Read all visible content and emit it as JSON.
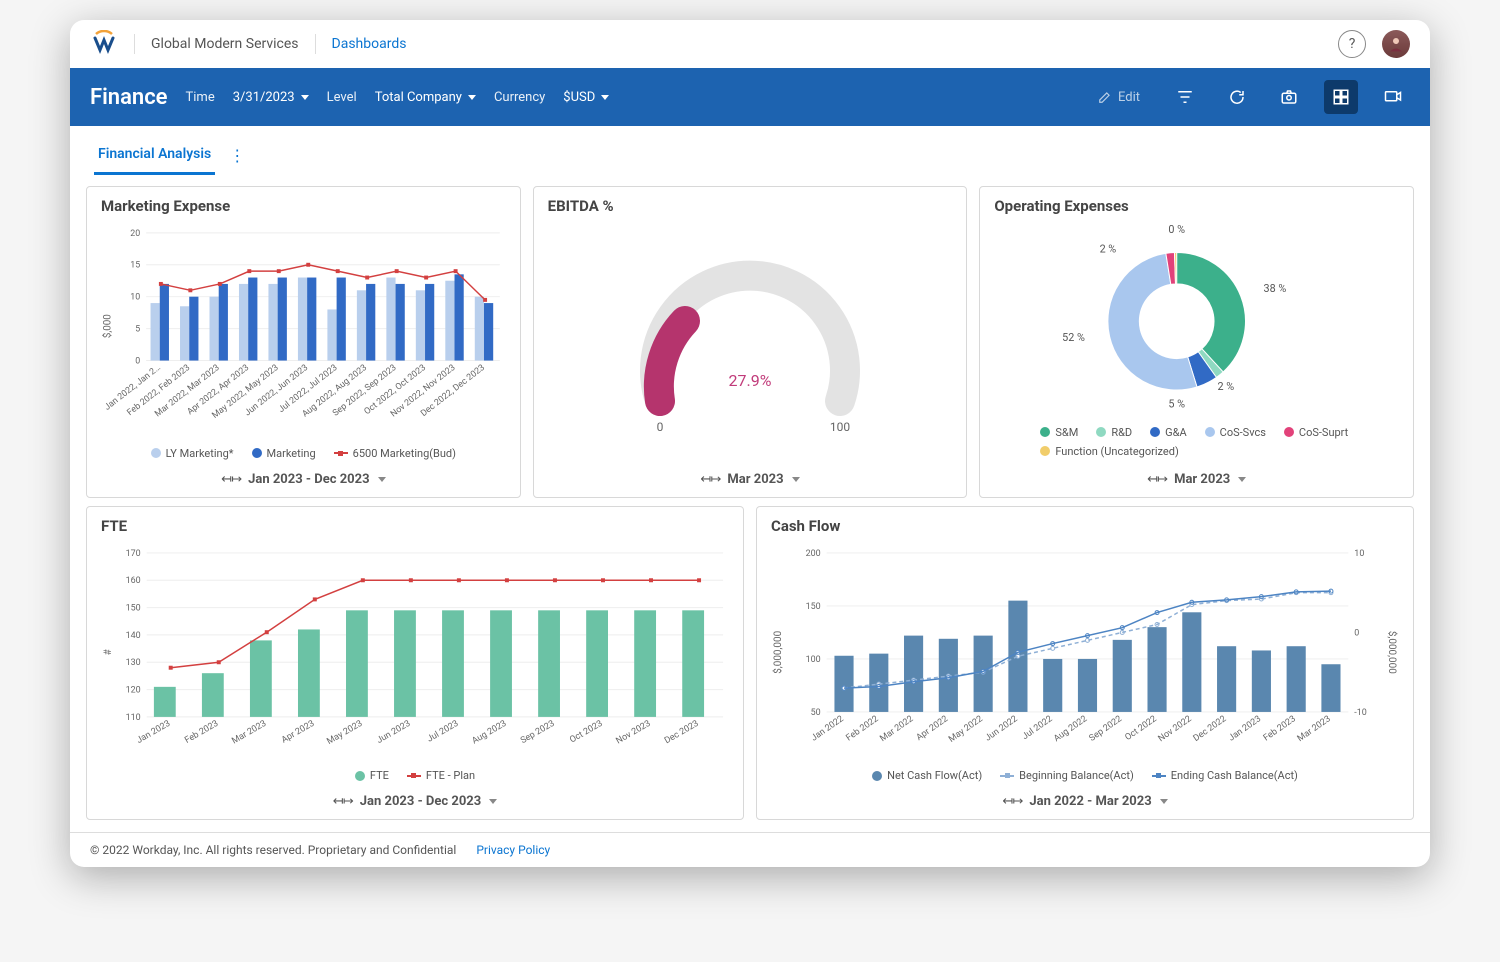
{
  "nav": {
    "brand": "Global Modern Services",
    "breadcrumb": "Dashboards"
  },
  "bluebar": {
    "title": "Finance",
    "filters": {
      "time_label": "Time",
      "time_value": "3/31/2023",
      "level_label": "Level",
      "level_value": "Total Company",
      "currency_label": "Currency",
      "currency_value": "$USD"
    },
    "edit": "Edit"
  },
  "tab": "Financial Analysis",
  "cards": {
    "marketing": {
      "title": "Marketing Expense",
      "footer": "Jan 2023 - Dec 2023",
      "legend": [
        "LY Marketing*",
        "Marketing",
        "6500 Marketing(Bud)"
      ]
    },
    "ebitda": {
      "title": "EBITDA %",
      "footer": "Mar 2023",
      "value": "27.9%",
      "min": "0",
      "max": "100"
    },
    "opex": {
      "title": "Operating Expenses",
      "footer": "Mar 2023",
      "legend": [
        "S&M",
        "R&D",
        "G&A",
        "CoS-Svcs",
        "CoS-Suprt",
        "Function (Uncategorized)"
      ]
    },
    "fte": {
      "title": "FTE",
      "footer": "Jan 2023 - Dec 2023",
      "legend": [
        "FTE",
        "FTE - Plan"
      ]
    },
    "cash": {
      "title": "Cash Flow",
      "footer": "Jan 2022 - Mar 2023",
      "legend": [
        "Net Cash Flow(Act)",
        "Beginning Balance(Act)",
        "Ending Cash Balance(Act)"
      ]
    }
  },
  "footer": {
    "copyright": "© 2022 Workday, Inc. All rights reserved. Proprietary and Confidential",
    "link": "Privacy Policy"
  },
  "chart_data": [
    {
      "id": "marketing_expense",
      "type": "bar+line",
      "ylabel": "$,000",
      "ylim": [
        0,
        20
      ],
      "yticks": [
        0,
        5,
        10,
        15,
        20
      ],
      "categories": [
        "Jan 2022, Jan 2…",
        "Feb 2022, Feb 2023",
        "Mar 2022, Mar 2023",
        "Apr 2022, Apr 2023",
        "May 2022, May 2023",
        "Jun 2022, Jun 2023",
        "Jul 2022, Jul 2023",
        "Aug 2022, Aug 2023",
        "Sep 2022, Sep 2023",
        "Oct 2022, Oct 2023",
        "Nov 2022, Nov 2023",
        "Dec 2022, Dec 2023"
      ],
      "series": [
        {
          "name": "LY Marketing*",
          "type": "bar",
          "color": "#b9cfed",
          "values": [
            9,
            8.5,
            10,
            12,
            12,
            13,
            8,
            11,
            13,
            11,
            12.5,
            10
          ]
        },
        {
          "name": "Marketing",
          "type": "bar",
          "color": "#316ac5",
          "values": [
            12,
            10,
            12,
            13,
            13,
            13,
            13,
            12,
            12,
            12,
            13.5,
            9
          ]
        },
        {
          "name": "6500 Marketing(Bud)",
          "type": "line",
          "color": "#d34040",
          "values": [
            12,
            11,
            12,
            14,
            14,
            15,
            14,
            13,
            14,
            13,
            14,
            9.5
          ]
        }
      ]
    },
    {
      "id": "ebitda",
      "type": "gauge",
      "value": 27.9,
      "min": 0,
      "max": 100
    },
    {
      "id": "operating_expenses",
      "type": "donut",
      "series": [
        {
          "name": "S&M",
          "value": 38,
          "color": "#3cb08b"
        },
        {
          "name": "R&D",
          "value": 2,
          "color": "#8fd9c1"
        },
        {
          "name": "G&A",
          "value": 5,
          "color": "#316ac5"
        },
        {
          "name": "CoS-Svcs",
          "value": 52,
          "color": "#a9c7ee"
        },
        {
          "name": "CoS-Suprt",
          "value": 2,
          "color": "#e2427a"
        },
        {
          "name": "Function (Uncategorized)",
          "value": 0,
          "color": "#f1cd6b"
        }
      ],
      "labels": [
        "38 %",
        "2 %",
        "5 %",
        "52 %",
        "2 %",
        "0 %"
      ]
    },
    {
      "id": "fte",
      "type": "bar+line",
      "ylabel": "#",
      "ylim": [
        110,
        170
      ],
      "yticks": [
        110,
        120,
        130,
        140,
        150,
        160,
        170
      ],
      "categories": [
        "Jan 2023",
        "Feb 2023",
        "Mar 2023",
        "Apr 2023",
        "May 2023",
        "Jun 2023",
        "Jul 2023",
        "Aug 2023",
        "Sep 2023",
        "Oct 2023",
        "Nov 2023",
        "Dec 2023"
      ],
      "series": [
        {
          "name": "FTE",
          "type": "bar",
          "color": "#6bc2a5",
          "values": [
            121,
            126,
            138,
            142,
            149,
            149,
            149,
            149,
            149,
            149,
            149,
            149
          ]
        },
        {
          "name": "FTE - Plan",
          "type": "line",
          "color": "#d34040",
          "values": [
            128,
            130,
            141,
            153,
            160,
            160,
            160,
            160,
            160,
            160,
            160,
            160
          ]
        }
      ]
    },
    {
      "id": "cash_flow",
      "type": "bar+line",
      "ylabel": "$,000,000",
      "ylabel2": "$,000,000",
      "ylim": [
        50,
        200
      ],
      "ylim2": [
        -10,
        10
      ],
      "yticks": [
        50,
        100,
        150,
        200
      ],
      "yticks2": [
        -10,
        0,
        10
      ],
      "categories": [
        "Jan 2022",
        "Feb 2022",
        "Mar 2022",
        "Apr 2022",
        "May 2022",
        "Jun 2022",
        "Jul 2022",
        "Aug 2022",
        "Sep 2022",
        "Oct 2022",
        "Nov 2022",
        "Dec 2022",
        "Jan 2023",
        "Feb 2023",
        "Mar 2023"
      ],
      "series": [
        {
          "name": "Net Cash Flow(Act)",
          "type": "bar",
          "color": "#5a87af",
          "axis": 1,
          "values": [
            103,
            105,
            122,
            119,
            122,
            155,
            100,
            100,
            118,
            130,
            144,
            112,
            108,
            112,
            95
          ]
        },
        {
          "name": "Beginning Balance(Act)",
          "type": "line",
          "color": "#8fb0d6",
          "dashed": true,
          "axis": 2,
          "values": [
            -7,
            -6.5,
            -6,
            -5.5,
            -5,
            -3,
            -2,
            -1,
            0,
            1,
            3.5,
            4,
            4.2,
            5,
            5
          ]
        },
        {
          "name": "Ending Cash Balance(Act)",
          "type": "line",
          "color": "#4d84c3",
          "axis": 2,
          "values": [
            -7,
            -6.8,
            -6.2,
            -5.7,
            -4.9,
            -2.5,
            -1.4,
            -0.4,
            0.6,
            2.5,
            3.8,
            4.1,
            4.5,
            5.1,
            5.2
          ]
        }
      ]
    }
  ]
}
